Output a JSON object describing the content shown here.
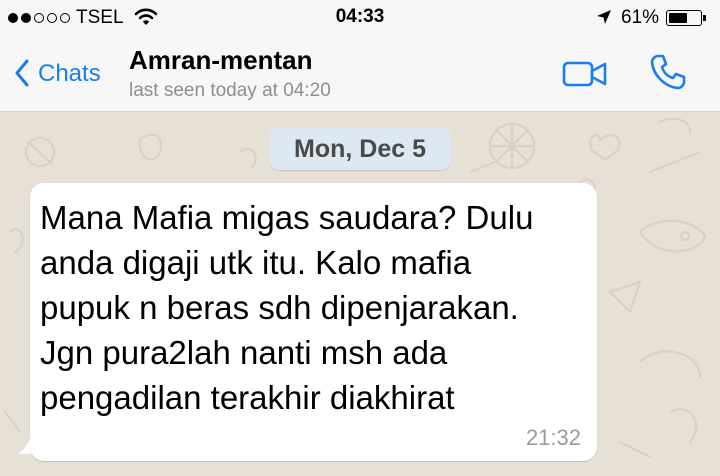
{
  "status_bar": {
    "carrier": "TSEL",
    "time": "04:33",
    "battery_percent": "61%",
    "battery_level": 0.61,
    "signal_bars_filled": 2,
    "signal_bars_total": 5,
    "icons": [
      "signal-dots-icon",
      "wifi-icon",
      "location-arrow-icon",
      "battery-icon"
    ]
  },
  "nav": {
    "back_label": "Chats",
    "contact_name": "Amran-mentan",
    "last_seen": "last seen today at 04:20",
    "accent_color": "#1a7ef0",
    "icons": [
      "chevron-left-icon",
      "video-call-icon",
      "phone-call-icon"
    ]
  },
  "chat": {
    "date_label": "Mon, Dec 5",
    "messages": [
      {
        "direction": "incoming",
        "text": "Mana Mafia migas saudara? Dulu\nanda digaji utk itu. Kalo mafia\npupuk n beras sdh dipenjarakan.\nJgn pura2lah nanti msh ada\npengadilan terakhir diakhirat",
        "time": "21:32"
      }
    ]
  }
}
